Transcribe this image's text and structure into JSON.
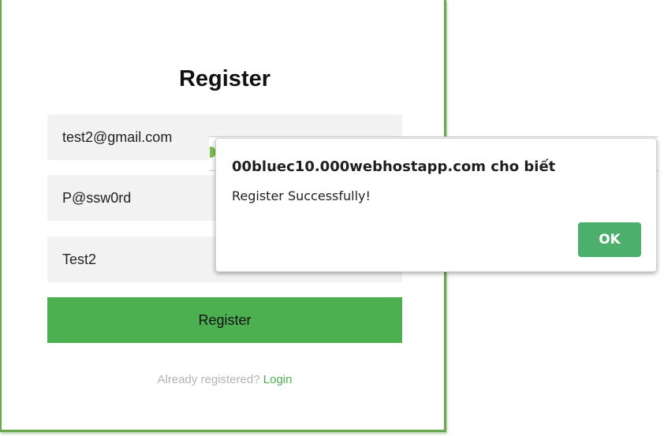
{
  "register_form": {
    "title": "Register",
    "email_value": "test2@gmail.com",
    "password_value": "P@ssw0rd",
    "name_value": "Test2",
    "submit_label": "Register",
    "footer_prompt": "Already registered?",
    "login_link": "Login"
  },
  "alert_dialog": {
    "title": "00bluec10.000webhostapp.com cho biết",
    "message": "Register Successfully!",
    "ok_label": "OK"
  },
  "colors": {
    "accent_green": "#4caf50",
    "frame_green": "#6aa84f",
    "ok_button": "#4caf6b",
    "field_bg": "#f2f2f2"
  }
}
